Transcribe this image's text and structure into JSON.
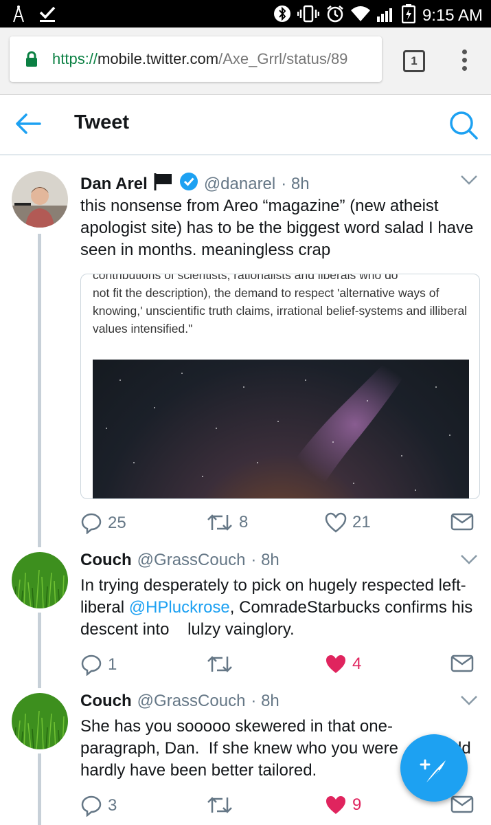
{
  "status_bar": {
    "time": "9:15 AM",
    "battery_icon": "battery-charging-icon",
    "icons": [
      "signal-tower-icon",
      "download-check-icon",
      "bluetooth-icon",
      "vibrate-icon",
      "alarm-icon",
      "wifi-icon",
      "cellular-icon"
    ]
  },
  "browser": {
    "url_scheme": "https://",
    "url_host": "mobile.twitter.com",
    "url_path": "/Axe_Grrl/status/89",
    "tab_count": "1"
  },
  "header": {
    "title": "Tweet"
  },
  "colors": {
    "twitter_blue": "#1da1f2",
    "like_red": "#e0245e",
    "muted": "#657786"
  },
  "tweets": [
    {
      "name": "Dan Arel",
      "handle": "@danarel",
      "time": "· 8h",
      "text": "this nonsense from Areo “magazine” (new atheist apologist site) has to be the biggest word salad I have seen in months. meaningless crap",
      "card_text_clipped": "contributions of scientists, rationalists and liberals who do",
      "card_text": "not fit the description), the demand to respect 'alternative ways of knowing,' unscientific truth claims, irrational belief-systems and illiberal values intensified.\"",
      "replies": "25",
      "retweets": "8",
      "likes": "21"
    },
    {
      "name": "Couch",
      "handle": "@GrassCouch",
      "time": "· 8h",
      "text_before": "In trying desperately to pick on hugely respected left-liberal ",
      "mention": "@HPluckrose",
      "text_after": ", ComradeStarbucks confirms his descent into    lulzy vainglory.",
      "replies": "1",
      "retweets": "",
      "likes": "4"
    },
    {
      "name": "Couch",
      "handle": "@GrassCouch",
      "time": "· 8h",
      "text_line1": "She has you sooooo skewered in that one-",
      "text_line2a": "paragraph, Dan.  If she knew who you were",
      "text_line2b": "ld",
      "text_line3": "hardly have been better tailored.",
      "replies": "3",
      "retweets": "",
      "likes": "9"
    }
  ]
}
